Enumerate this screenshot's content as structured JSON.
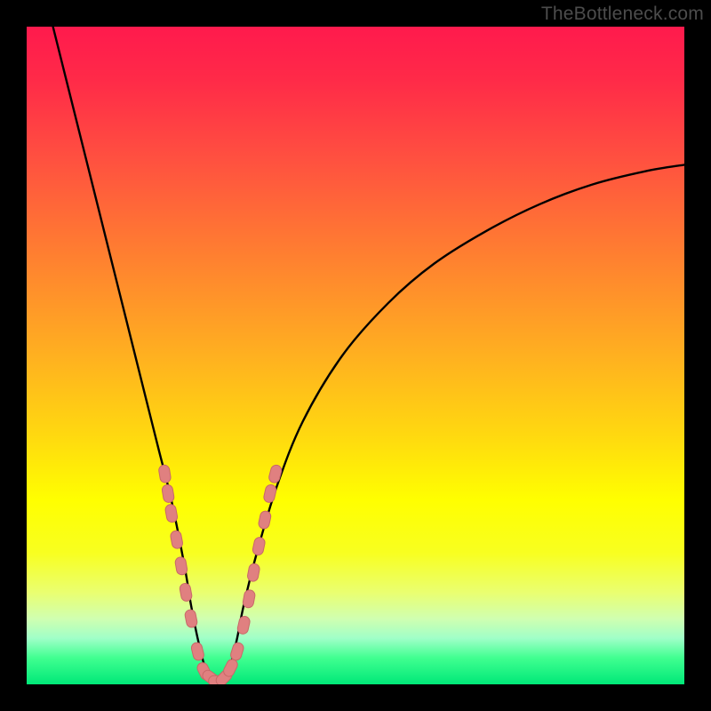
{
  "watermark": "TheBottleneck.com",
  "colors": {
    "frame": "#000000",
    "curve": "#000000",
    "markers_fill": "#e08080",
    "markers_stroke": "#c86868",
    "gradient_stops": [
      {
        "offset": 0.0,
        "color": "#ff1a4d"
      },
      {
        "offset": 0.08,
        "color": "#ff2a48"
      },
      {
        "offset": 0.2,
        "color": "#ff5040"
      },
      {
        "offset": 0.35,
        "color": "#ff8030"
      },
      {
        "offset": 0.5,
        "color": "#ffb020"
      },
      {
        "offset": 0.62,
        "color": "#ffd810"
      },
      {
        "offset": 0.72,
        "color": "#ffff00"
      },
      {
        "offset": 0.8,
        "color": "#f8ff20"
      },
      {
        "offset": 0.86,
        "color": "#eaff70"
      },
      {
        "offset": 0.9,
        "color": "#d0ffb0"
      },
      {
        "offset": 0.93,
        "color": "#a0ffc8"
      },
      {
        "offset": 0.96,
        "color": "#40ff90"
      },
      {
        "offset": 1.0,
        "color": "#00e878"
      }
    ]
  },
  "chart_data": {
    "type": "line",
    "title": "",
    "xlabel": "",
    "ylabel": "",
    "xlim": [
      0,
      100
    ],
    "ylim": [
      0,
      100
    ],
    "note": "V-shaped bottleneck curve; x is an implicit component-balance axis (unlabeled), y is bottleneck % (0 = no bottleneck at green bottom, 100 = severe at red top). Values estimated from pixel positions.",
    "series": [
      {
        "name": "bottleneck-curve",
        "x": [
          4,
          6,
          8,
          10,
          12,
          14,
          16,
          18,
          20,
          22,
          24,
          25,
          26,
          27,
          28,
          29,
          30,
          31,
          32,
          33,
          35,
          38,
          42,
          48,
          55,
          62,
          70,
          78,
          86,
          94,
          100
        ],
        "y": [
          100,
          92,
          84,
          76,
          68,
          60,
          52,
          44,
          36,
          28,
          18,
          12,
          7,
          3,
          1,
          0.5,
          1,
          3,
          7,
          12,
          20,
          30,
          40,
          50,
          58,
          64,
          69,
          73,
          76,
          78,
          79
        ]
      }
    ],
    "markers": {
      "name": "highlighted-range",
      "note": "Salmon capsule markers clustered on both flanks of the valley near the minimum.",
      "points": [
        {
          "x": 21.0,
          "y": 32
        },
        {
          "x": 21.5,
          "y": 29
        },
        {
          "x": 22.0,
          "y": 26
        },
        {
          "x": 22.8,
          "y": 22
        },
        {
          "x": 23.5,
          "y": 18
        },
        {
          "x": 24.2,
          "y": 14
        },
        {
          "x": 25.0,
          "y": 10
        },
        {
          "x": 26.0,
          "y": 5
        },
        {
          "x": 27.0,
          "y": 2
        },
        {
          "x": 28.0,
          "y": 1
        },
        {
          "x": 29.0,
          "y": 0.5
        },
        {
          "x": 30.0,
          "y": 1
        },
        {
          "x": 31.0,
          "y": 2.5
        },
        {
          "x": 32.0,
          "y": 5
        },
        {
          "x": 33.0,
          "y": 9
        },
        {
          "x": 33.8,
          "y": 13
        },
        {
          "x": 34.5,
          "y": 17
        },
        {
          "x": 35.3,
          "y": 21
        },
        {
          "x": 36.2,
          "y": 25
        },
        {
          "x": 37.0,
          "y": 29
        },
        {
          "x": 37.8,
          "y": 32
        }
      ]
    }
  }
}
